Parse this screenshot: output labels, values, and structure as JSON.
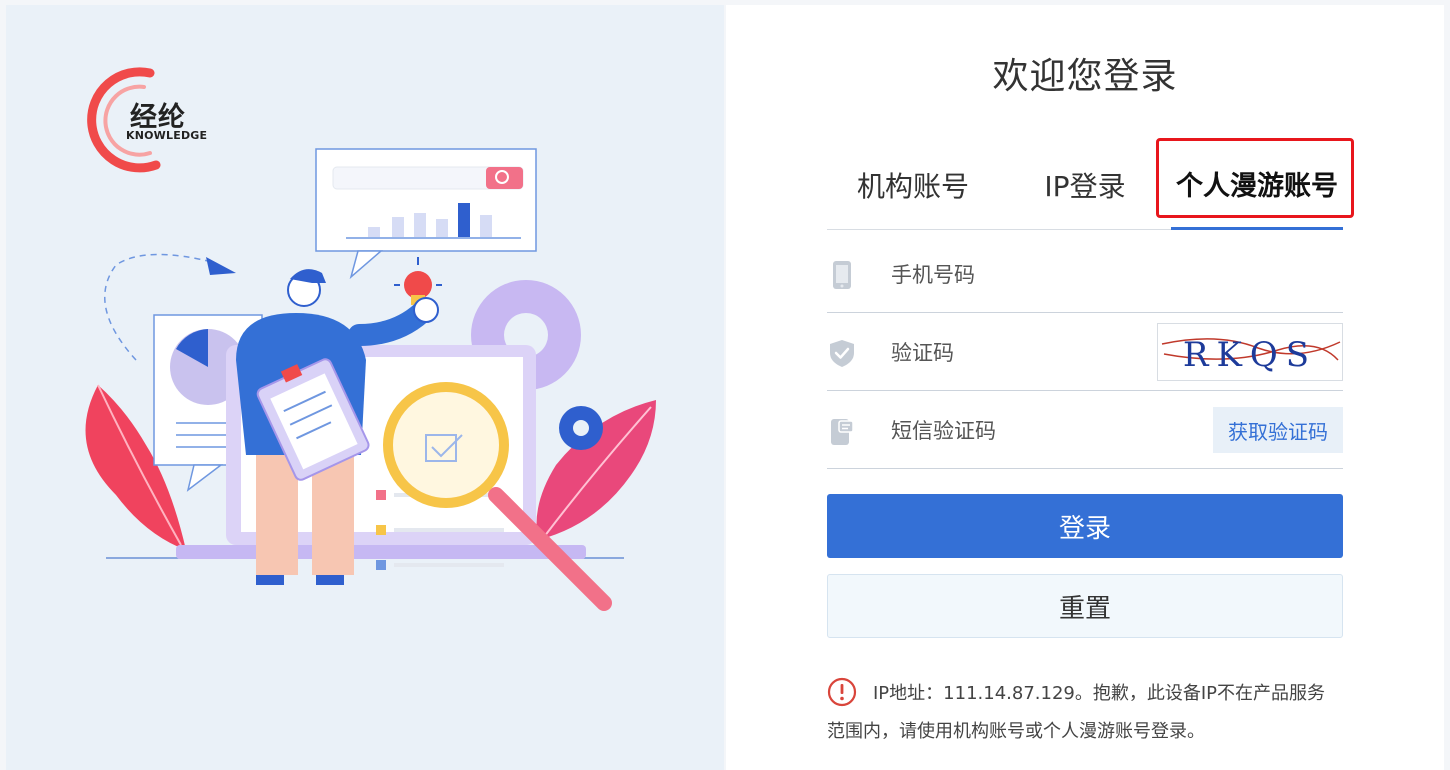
{
  "logo": {
    "cn": "经纶",
    "en": "KNOWLEDGE"
  },
  "login": {
    "title": "欢迎您登录",
    "tabs": [
      {
        "label": "机构账号"
      },
      {
        "label": "IP登录"
      },
      {
        "label": "个人漫游账号",
        "active": true
      }
    ],
    "fields": {
      "phone_placeholder": "手机号码",
      "captcha_placeholder": "验证码",
      "captcha_image_text": "RKQS",
      "sms_placeholder": "短信验证码",
      "sms_button": "获取验证码"
    },
    "login_button": "登录",
    "reset_button": "重置",
    "notice_line1": "IP地址：111.14.87.129。抱歉，此设备IP不在产品服务",
    "notice_line2": "范围内，请使用机构账号或个人漫游账号登录。"
  },
  "colors": {
    "primary": "#3470d6",
    "highlight_border": "#e8161c",
    "left_panel_bg": "#eaf1f8",
    "notice_icon": "#d9453b"
  },
  "icons": {
    "phone_field": "mobile-phone-icon",
    "captcha_field": "shield-check-icon",
    "sms_field": "sms-phone-icon",
    "notice": "exclamation-circle-icon"
  }
}
